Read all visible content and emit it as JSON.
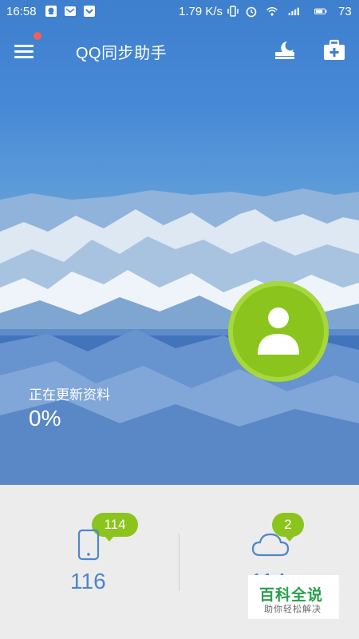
{
  "status_bar": {
    "time": "16:58",
    "net_speed": "1.79 K/s",
    "battery": "73",
    "icons": [
      "qq-notification-icon",
      "mail-icon",
      "download-icon",
      "vibrate-icon",
      "alarm-icon",
      "wifi-icon",
      "signal-icon",
      "battery-icon"
    ]
  },
  "app_bar": {
    "title": "QQ同步助手",
    "icons": [
      "menu-icon",
      "night-mode-icon",
      "toolbox-icon"
    ],
    "notification_dot_color": "#f35d5d"
  },
  "sync": {
    "status": "正在更新资料",
    "progress": "0%",
    "avatar_color": "#8bc41d"
  },
  "stats": {
    "phone": {
      "badge": "114",
      "count": "116",
      "icon": "phone-icon"
    },
    "cloud": {
      "badge": "2",
      "count": "114",
      "icon": "cloud-icon"
    }
  },
  "watermark": {
    "title": "百科全说",
    "subtitle": "助你轻松解决"
  },
  "colors": {
    "accent_green": "#8bc41d",
    "count_blue": "#4f86c6",
    "sky_blue": "#3e7fce"
  }
}
